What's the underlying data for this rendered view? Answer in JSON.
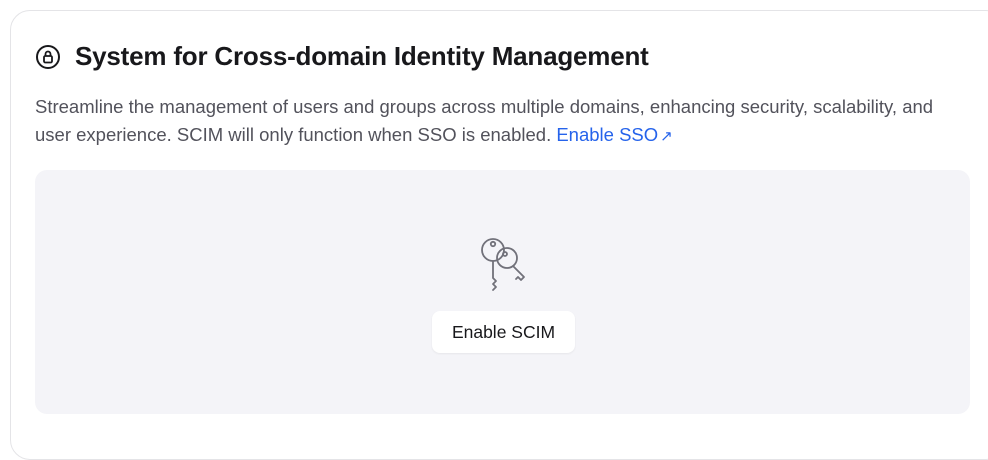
{
  "section": {
    "icon": "lock-circle-icon",
    "title": "System for Cross-domain Identity Management",
    "description": "Streamline the management of users and groups across multiple domains, enhancing security, scalability, and user experience. SCIM will only function when SSO is enabled.",
    "enable_sso_link": "Enable SSO",
    "enable_sso_arrow": "↗"
  },
  "panel": {
    "icon": "keys-icon",
    "enable_scim_button": "Enable SCIM"
  },
  "colors": {
    "link": "#2563eb",
    "panel_bg": "#f4f4f8",
    "title": "#18181b",
    "text": "#52525b"
  }
}
